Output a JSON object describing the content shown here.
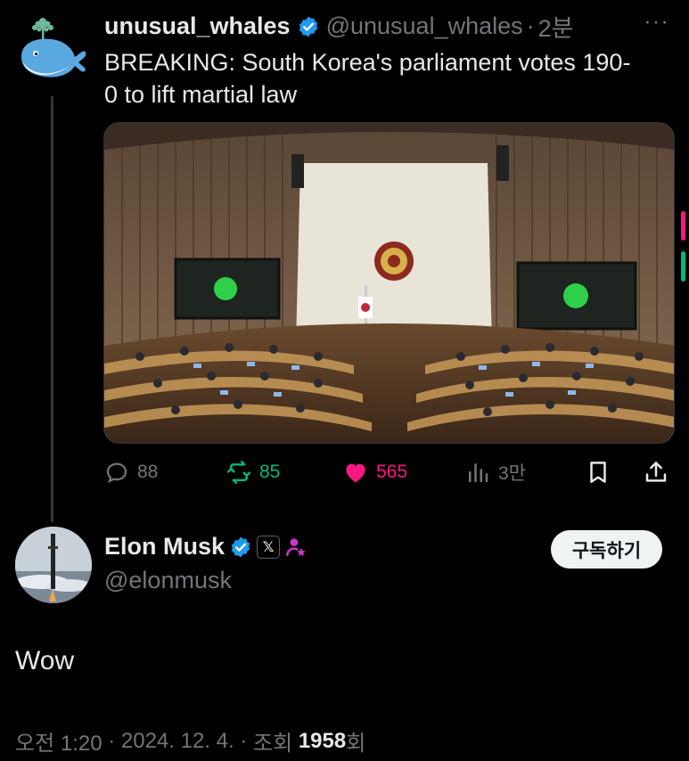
{
  "tweet1": {
    "name": "unusual_whales",
    "handle": "@unusual_whales",
    "separator": "·",
    "time": "2분",
    "more": "···",
    "text": "BREAKING: South Korea's parliament votes 190-0 to lift martial law",
    "actions": {
      "replies": "88",
      "retweets": "85",
      "likes": "565",
      "views": "3만"
    }
  },
  "tweet2": {
    "name": "Elon Musk",
    "handle": "@elonmusk",
    "affiliate_badge": "𝕏",
    "subscribe_label": "구독하기",
    "text": "Wow",
    "meta": {
      "time": "오전 1:20",
      "sep1": " · ",
      "date": "2024. 12. 4.",
      "sep2": " · ",
      "views_prefix": "조회 ",
      "views_count": "1958",
      "views_suffix": "회"
    }
  },
  "icons": {
    "verified": "verified-badge-icon",
    "reply": "reply-icon",
    "retweet": "retweet-icon",
    "like": "heart-icon",
    "views": "views-icon",
    "bookmark": "bookmark-icon",
    "share": "share-icon"
  },
  "colors": {
    "background": "#000000",
    "text": "#e7e9ea",
    "muted": "#71767b",
    "verified": "#1d9bf0",
    "retweet": "#00ba7c",
    "like": "#f91880",
    "subscriber": "#c936cc"
  }
}
